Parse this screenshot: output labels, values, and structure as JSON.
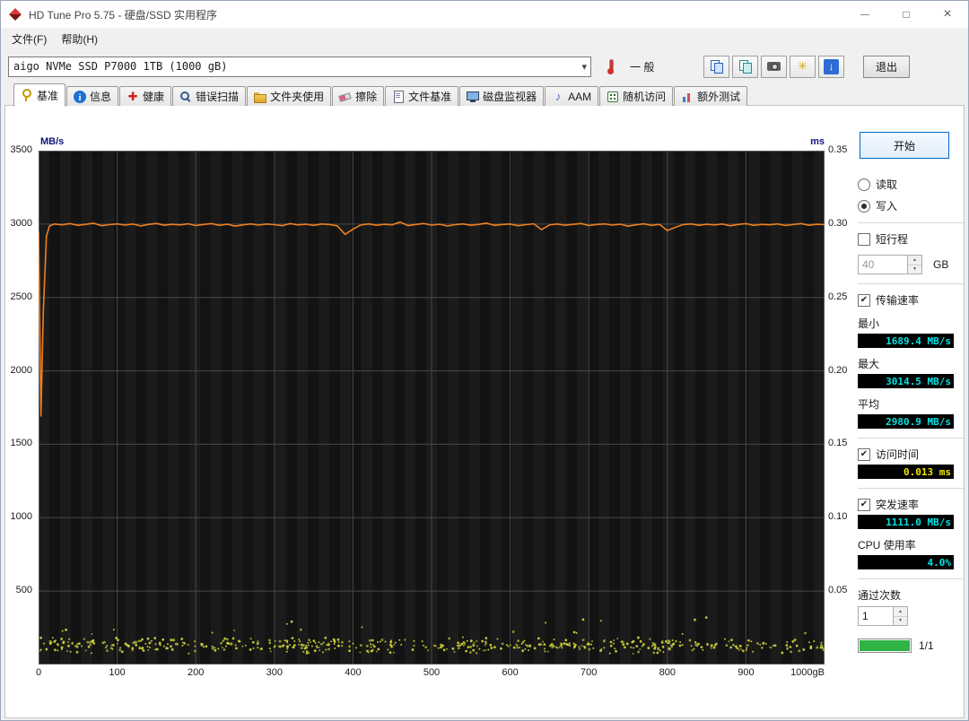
{
  "window": {
    "title": "HD Tune Pro 5.75 - 硬盘/SSD 实用程序"
  },
  "menubar": {
    "file": "文件(F)",
    "help": "帮助(H)"
  },
  "toolbar": {
    "drive_selector_value": "aigo NVMe SSD P7000 1TB (1000 gB)",
    "temperature_status": "一 般",
    "exit_label": "退出"
  },
  "tabs": [
    {
      "label": "基准",
      "active": true
    },
    {
      "label": "信息",
      "active": false
    },
    {
      "label": "健康",
      "active": false
    },
    {
      "label": "错误扫描",
      "active": false
    },
    {
      "label": "文件夹使用",
      "active": false
    },
    {
      "label": "擦除",
      "active": false
    },
    {
      "label": "文件基准",
      "active": false
    },
    {
      "label": "磁盘监视器",
      "active": false
    },
    {
      "label": "AAM",
      "active": false
    },
    {
      "label": "随机访问",
      "active": false
    },
    {
      "label": "额外测试",
      "active": false
    }
  ],
  "controls": {
    "start_button": "开始",
    "read_label": "读取",
    "read_selected": false,
    "write_label": "写入",
    "write_selected": true,
    "short_stroke_label": "短行程",
    "short_stroke_checked": false,
    "capacity_value": "40",
    "capacity_unit": "GB",
    "transfer_rate_label": "传输速率",
    "transfer_rate_checked": true,
    "min_label": "最小",
    "min_value": "1689.4 MB/s",
    "max_label": "最大",
    "max_value": "3014.5 MB/s",
    "avg_label": "平均",
    "avg_value": "2980.9 MB/s",
    "access_time_label": "访问时间",
    "access_time_checked": true,
    "access_time_value": "0.013 ms",
    "burst_rate_label": "突发速率",
    "burst_rate_checked": true,
    "burst_rate_value": "1111.0 MB/s",
    "cpu_usage_label": "CPU 使用率",
    "cpu_usage_value": "4.0%",
    "pass_count_label": "通过次数",
    "pass_count_value": "1",
    "pass_progress_label": "1/1",
    "pass_progress_percent": 100,
    "accent_colors": {
      "value_cyan": "#00e5e5",
      "value_yellow": "#f2e400",
      "progress_green": "#2fb344"
    }
  },
  "chart_data": {
    "type": "line",
    "title": "",
    "background": "#131313",
    "grid_color": "#484848",
    "x_axis": {
      "min": 0,
      "max": 1000,
      "tick_labels": [
        "0",
        "100",
        "200",
        "300",
        "400",
        "500",
        "600",
        "700",
        "800",
        "900",
        "1000gB"
      ]
    },
    "y_left": {
      "label": "MB/s",
      "min": 0,
      "max": 3500,
      "tick_labels": [
        "3500",
        "3000",
        "2500",
        "2000",
        "1500",
        "1000",
        "500"
      ]
    },
    "y_right": {
      "label": "ms",
      "min": 0,
      "max": 0.35,
      "tick_labels": [
        "0.35",
        "0.30",
        "0.25",
        "0.20",
        "0.15",
        "0.10",
        "0.05"
      ]
    },
    "series": [
      {
        "name": "transfer-rate",
        "axis": "left",
        "color": "#ef8020",
        "style": "line",
        "points": [
          [
            0,
            2950
          ],
          [
            3,
            1689
          ],
          [
            6,
            2400
          ],
          [
            10,
            2920
          ],
          [
            14,
            2988
          ],
          [
            20,
            3000
          ],
          [
            30,
            2995
          ],
          [
            40,
            3003
          ],
          [
            50,
            2991
          ],
          [
            60,
            2998
          ],
          [
            70,
            3006
          ],
          [
            80,
            2989
          ],
          [
            90,
            2996
          ],
          [
            100,
            3001
          ],
          [
            110,
            2993
          ],
          [
            120,
            3000
          ],
          [
            130,
            2987
          ],
          [
            140,
            2998
          ],
          [
            150,
            3004
          ],
          [
            160,
            2992
          ],
          [
            170,
            2999
          ],
          [
            180,
            2994
          ],
          [
            190,
            3002
          ],
          [
            200,
            2990
          ],
          [
            210,
            2997
          ],
          [
            220,
            3003
          ],
          [
            230,
            2991
          ],
          [
            240,
            2999
          ],
          [
            250,
            2986
          ],
          [
            260,
            2995
          ],
          [
            270,
            3001
          ],
          [
            280,
            2993
          ],
          [
            290,
            3000
          ],
          [
            300,
            2996
          ],
          [
            310,
            2989
          ],
          [
            320,
            3003
          ],
          [
            330,
            2994
          ],
          [
            340,
            2999
          ],
          [
            350,
            2991
          ],
          [
            360,
            3000
          ],
          [
            370,
            2997
          ],
          [
            380,
            2988
          ],
          [
            390,
            2930
          ],
          [
            400,
            2965
          ],
          [
            410,
            2994
          ],
          [
            420,
            3001
          ],
          [
            430,
            2992
          ],
          [
            440,
            2999
          ],
          [
            450,
            2995
          ],
          [
            460,
            3014
          ],
          [
            470,
            2990
          ],
          [
            480,
            2997
          ],
          [
            490,
            3004
          ],
          [
            500,
            2993
          ],
          [
            510,
            2999
          ],
          [
            520,
            2987
          ],
          [
            530,
            2996
          ],
          [
            540,
            3001
          ],
          [
            550,
            2992
          ],
          [
            560,
            2998
          ],
          [
            570,
            3006
          ],
          [
            580,
            2991
          ],
          [
            590,
            2997
          ],
          [
            600,
            3000
          ],
          [
            610,
            2989
          ],
          [
            620,
            2996
          ],
          [
            630,
            3002
          ],
          [
            640,
            2962
          ],
          [
            650,
            2994
          ],
          [
            660,
            3000
          ],
          [
            670,
            2992
          ],
          [
            680,
            2998
          ],
          [
            690,
            3004
          ],
          [
            700,
            2990
          ],
          [
            710,
            2997
          ],
          [
            720,
            3001
          ],
          [
            730,
            2993
          ],
          [
            740,
            2999
          ],
          [
            750,
            2986
          ],
          [
            760,
            2995
          ],
          [
            770,
            3002
          ],
          [
            780,
            2991
          ],
          [
            790,
            2998
          ],
          [
            800,
            2956
          ],
          [
            810,
            2978
          ],
          [
            820,
            2996
          ],
          [
            830,
            3001
          ],
          [
            840,
            2992
          ],
          [
            850,
            2999
          ],
          [
            860,
            2994
          ],
          [
            870,
            3000
          ],
          [
            880,
            2988
          ],
          [
            890,
            2997
          ],
          [
            900,
            3003
          ],
          [
            910,
            2991
          ],
          [
            920,
            2998
          ],
          [
            930,
            2995
          ],
          [
            940,
            3001
          ],
          [
            950,
            2990
          ],
          [
            960,
            2997
          ],
          [
            970,
            3003
          ],
          [
            980,
            2992
          ],
          [
            990,
            2999
          ],
          [
            1000,
            2996
          ]
        ]
      },
      {
        "name": "access-time",
        "axis": "right",
        "color": "#d4d43c",
        "style": "scatter",
        "summary": {
          "count": 550,
          "ms_min": 0.007,
          "ms_typical": 0.013,
          "ms_max": 0.032
        },
        "seed": 987654321
      }
    ]
  }
}
